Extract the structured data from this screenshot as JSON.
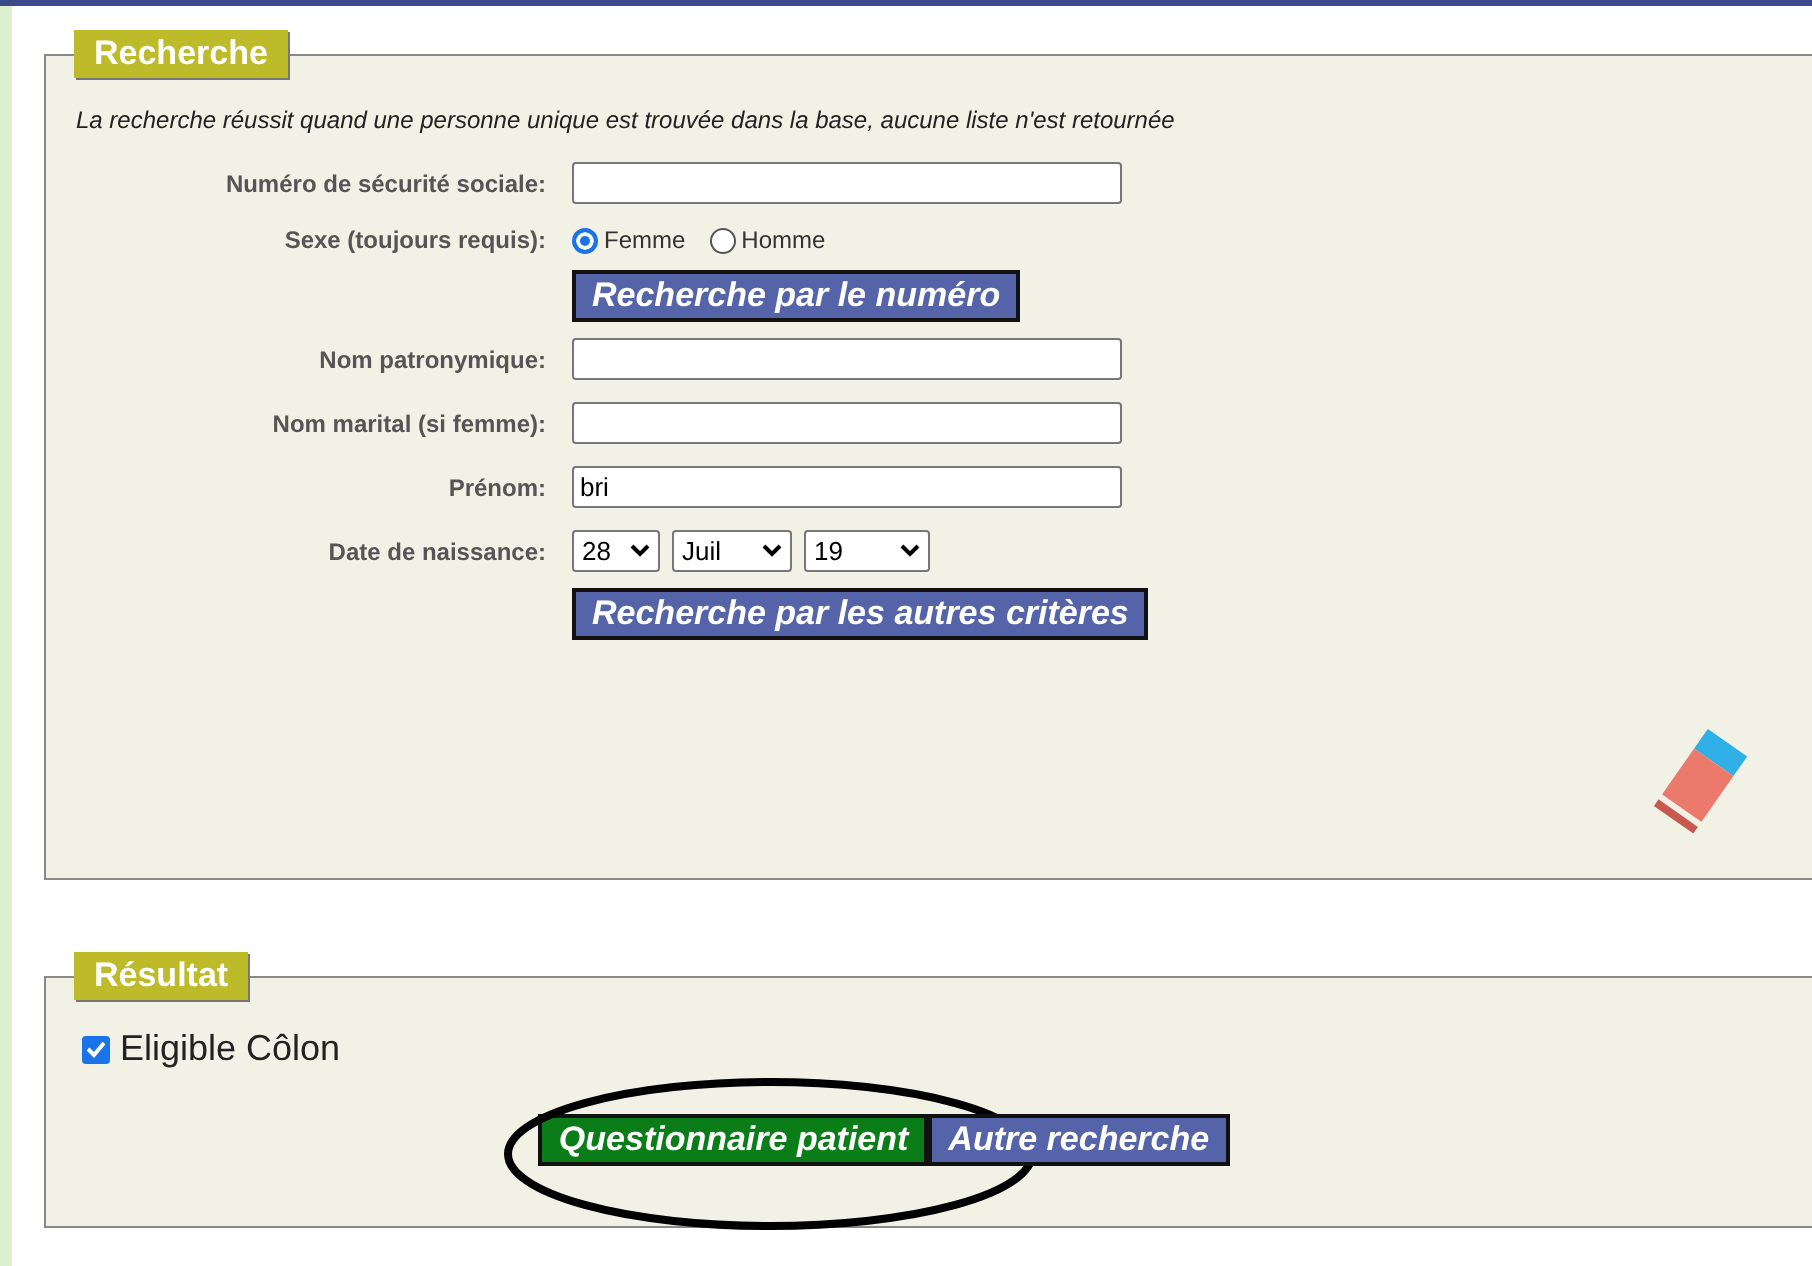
{
  "search_panel": {
    "legend": "Recherche",
    "note": "La recherche réussit quand une personne unique est trouvée dans la base, aucune liste n'est retournée",
    "rows": [
      {
        "kind": "text",
        "label": "Numéro de sécurité sociale:",
        "value": ""
      },
      {
        "kind": "radio",
        "label": "Sexe (toujours requis):",
        "options": [
          {
            "label": "Femme",
            "selected": true
          },
          {
            "label": "Homme",
            "selected": false
          }
        ]
      },
      {
        "kind": "button",
        "label": "Recherche par le numéro"
      },
      {
        "kind": "text",
        "label": "Nom patronymique:",
        "value": ""
      },
      {
        "kind": "text",
        "label": "Nom marital (si femme):",
        "value": ""
      },
      {
        "kind": "text",
        "label": "Prénom:",
        "value": "bri"
      },
      {
        "kind": "date",
        "label": "Date de naissance:",
        "selects": [
          "28",
          "Juil",
          "19"
        ]
      },
      {
        "kind": "button",
        "label": "Recherche par les autres critères"
      }
    ]
  },
  "result_panel": {
    "legend": "Résultat",
    "checkbox": {
      "label": "Eligible Côlon",
      "checked": true
    },
    "buttons": [
      {
        "label": "Questionnaire patient",
        "kind": "primary",
        "annotated": true
      },
      {
        "label": "Autre recherche",
        "kind": "secondary",
        "annotated": false
      }
    ]
  }
}
